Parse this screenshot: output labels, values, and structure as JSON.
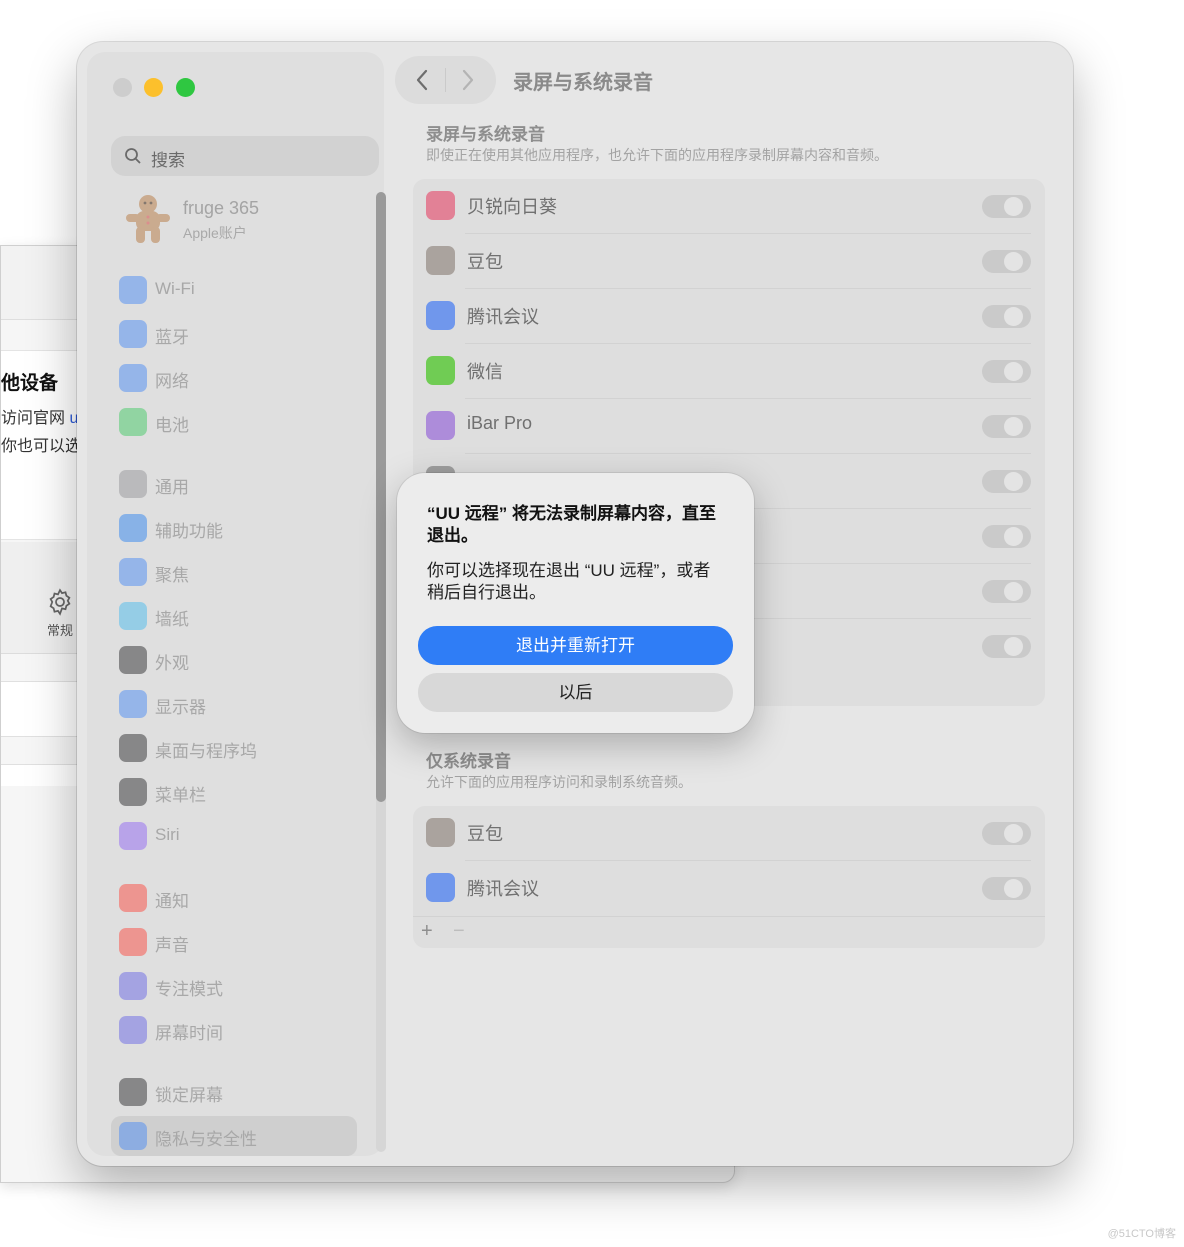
{
  "background_window": {
    "title_partial": "他设备",
    "line1_prefix": "访问官网 ",
    "line1_link": "uu",
    "line2": "你也可以选",
    "general_label": "常规"
  },
  "window": {
    "title": "录屏与系统录音",
    "search_placeholder": "搜索",
    "account": {
      "name": "fruge 365",
      "subtitle": "Apple账户"
    },
    "sidebar_items": [
      {
        "label": "Wi-Fi",
        "icon": "wifi-icon",
        "color": "#3b82f6"
      },
      {
        "label": "蓝牙",
        "icon": "bluetooth-icon",
        "color": "#3b82f6"
      },
      {
        "label": "网络",
        "icon": "globe-icon",
        "color": "#3b82f6"
      },
      {
        "label": "电池",
        "icon": "battery-icon",
        "color": "#34c759"
      },
      {
        "label": "通用",
        "icon": "gear-icon",
        "color": "#8e8e93"
      },
      {
        "label": "辅助功能",
        "icon": "accessibility-icon",
        "color": "#1e7cf2"
      },
      {
        "label": "聚焦",
        "icon": "magnifier-icon",
        "color": "#3b82f6"
      },
      {
        "label": "墙纸",
        "icon": "wallpaper-icon",
        "color": "#3bb8f0"
      },
      {
        "label": "外观",
        "icon": "appearance-icon",
        "color": "#1c1c1e"
      },
      {
        "label": "显示器",
        "icon": "display-icon",
        "color": "#3b82f6"
      },
      {
        "label": "桌面与程序坞",
        "icon": "dock-icon",
        "color": "#1c1c1e"
      },
      {
        "label": "菜单栏",
        "icon": "menubar-icon",
        "color": "#1c1c1e"
      },
      {
        "label": "Siri",
        "icon": "siri-icon",
        "color": "#8a5cf6"
      },
      {
        "label": "通知",
        "icon": "bell-icon",
        "color": "#ff3b30"
      },
      {
        "label": "声音",
        "icon": "speaker-icon",
        "color": "#ff3b30"
      },
      {
        "label": "专注模式",
        "icon": "moon-icon",
        "color": "#5e5ce6"
      },
      {
        "label": "屏幕时间",
        "icon": "hourglass-icon",
        "color": "#5e5ce6"
      },
      {
        "label": "锁定屏幕",
        "icon": "lock-icon",
        "color": "#1c1c1e"
      },
      {
        "label": "隐私与安全性",
        "icon": "hand-icon",
        "color": "#3b82f6"
      }
    ],
    "selected_sidebar_item": "隐私与安全性",
    "section1": {
      "title": "录屏与系统录音",
      "description": "即使正在使用其他应用程序，也允许下面的应用程序录制屏幕内容和音频。",
      "apps": [
        {
          "label": "贝锐向日葵",
          "icon": "sunflower-icon",
          "color": "#e5486a",
          "enabled": false
        },
        {
          "label": "豆包",
          "icon": "doubao-icon",
          "color": "#8a7f78",
          "enabled": false
        },
        {
          "label": "腾讯会议",
          "icon": "tencent-meeting-icon",
          "color": "#2d6cf5",
          "enabled": false
        },
        {
          "label": "微信",
          "icon": "wechat-icon",
          "color": "#2dc100",
          "enabled": false
        },
        {
          "label": "iBar Pro",
          "icon": "ibar-icon",
          "color": "#8f5bd8",
          "enabled": false
        },
        {
          "label": "",
          "icon": "app-icon",
          "color": "#777777",
          "enabled": false
        },
        {
          "label": "",
          "icon": "app-icon",
          "color": "#777777",
          "enabled": false
        },
        {
          "label": "",
          "icon": "app-icon",
          "color": "#777777",
          "enabled": false
        },
        {
          "label": "",
          "icon": "app-icon",
          "color": "#777777",
          "enabled": false
        }
      ]
    },
    "section2": {
      "title": "仅系统录音",
      "description": "允许下面的应用程序访问和录制系统音频。",
      "apps": [
        {
          "label": "豆包",
          "icon": "doubao-icon",
          "color": "#8a7f78",
          "enabled": false
        },
        {
          "label": "腾讯会议",
          "icon": "tencent-meeting-icon",
          "color": "#2d6cf5",
          "enabled": false
        }
      ],
      "add_symbol": "+",
      "remove_symbol": "−"
    }
  },
  "alert": {
    "title": "“UU 远程” 将无法录制屏幕内容，直至退出。",
    "message": "你可以选择现在退出 “UU 远程”，或者稍后自行退出。",
    "primary_button": "退出并重新打开",
    "secondary_button": "以后",
    "accent_color": "#2f7df6"
  },
  "watermark": "@51CTO博客"
}
